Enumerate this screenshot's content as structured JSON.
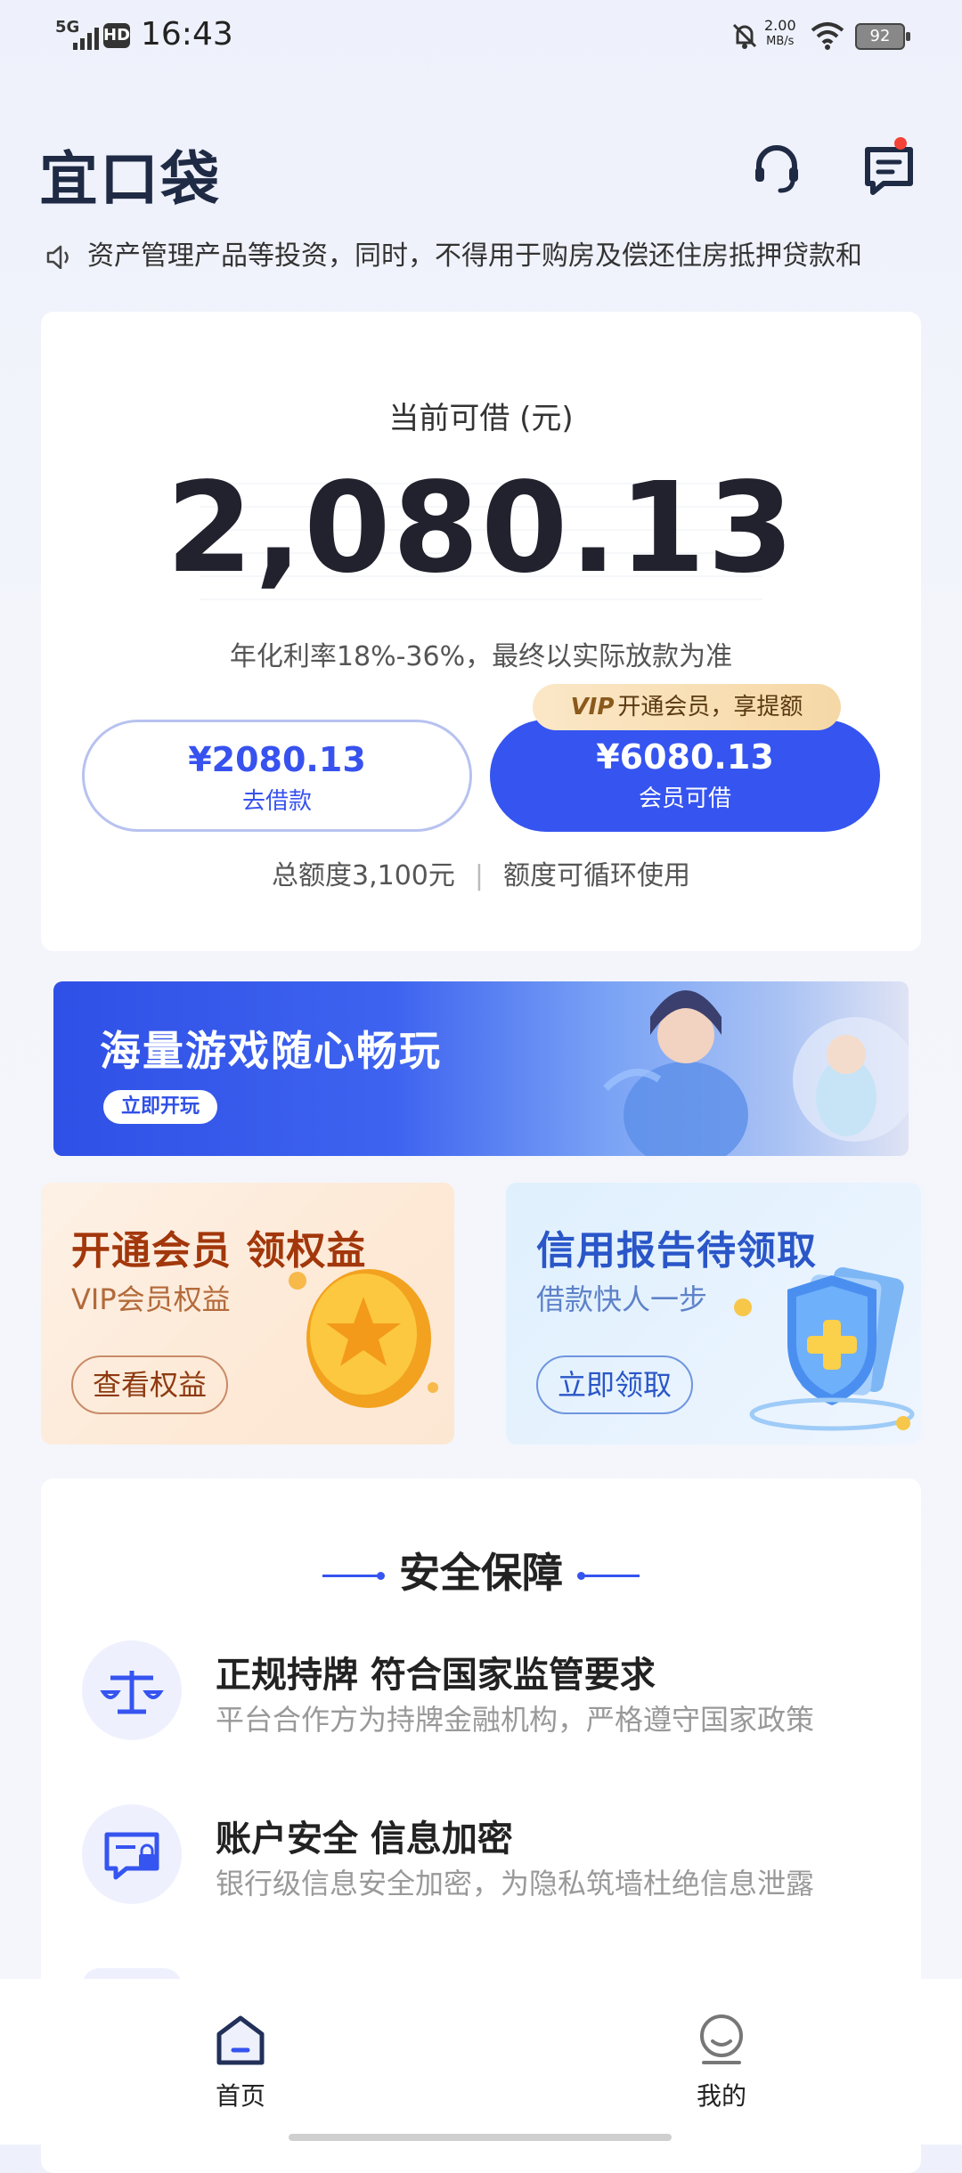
{
  "status": {
    "network": "5G",
    "hd": "HD",
    "time": "16:43",
    "speed": "2.00",
    "speed_unit": "MB/s",
    "battery": "92"
  },
  "header": {
    "logo": "宜口袋",
    "notice": "资产管理产品等投资，同时，不得用于购房及偿还住房抵押贷款和"
  },
  "loan_card": {
    "available_label": "当前可借 (元)",
    "amount": "2,080.13",
    "rate_note": "年化利率18%-36%，最终以实际放款为准",
    "borrow_value": "¥2080.13",
    "borrow_label": "去借款",
    "vip_tag_badge": "VIP",
    "vip_tag_text": "开通会员，享提额",
    "vip_value": "¥6080.13",
    "vip_label": "会员可借",
    "total_quota": "总额度3,100元",
    "quota_sep": "|",
    "cycle_note": "额度可循环使用"
  },
  "banner": {
    "title": "海量游戏随心畅玩",
    "button": "立即开玩"
  },
  "promos": [
    {
      "title": "开通会员 领权益",
      "subtitle": "VIP会员权益",
      "button": "查看权益"
    },
    {
      "title": "信用报告待领取",
      "subtitle": "借款快人一步",
      "button": "立即领取"
    }
  ],
  "safety": {
    "title": "安全保障",
    "features": [
      {
        "title": "正规持牌 符合国家监管要求",
        "desc": "平台合作方为持牌金融机构，严格遵守国家政策"
      },
      {
        "title": "账户安全 信息加密",
        "desc": "银行级信息安全加密，为隐私筑墙杜绝信息泄露"
      }
    ]
  },
  "nav": {
    "home": "首页",
    "mine": "我的"
  },
  "colors": {
    "primary": "#3554f0",
    "dark_text": "#22222e",
    "vip_gold": "#f6d8a6"
  }
}
